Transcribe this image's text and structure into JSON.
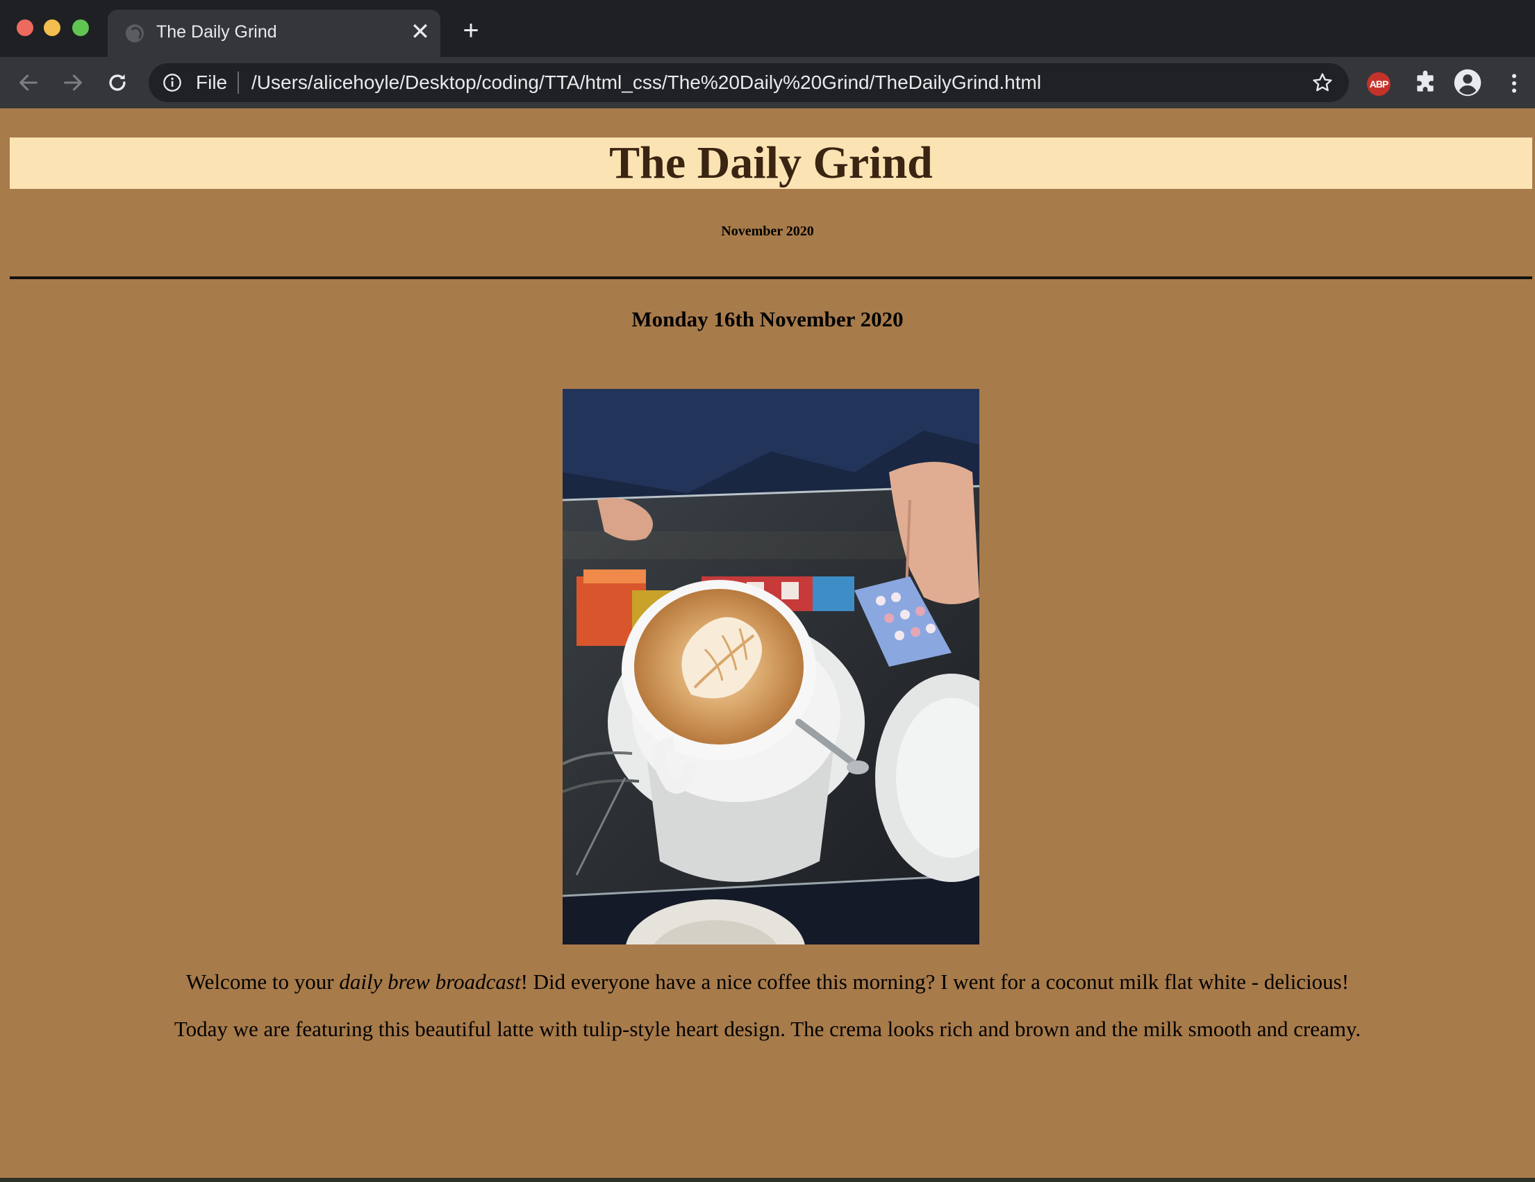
{
  "browser": {
    "tab_title": "The Daily Grind",
    "tab_close": "✕",
    "new_tab": "+",
    "address_scheme": "File",
    "address_url": "/Users/alicehoyle/Desktop/coding/TTA/html_css/The%20Daily%20Grind/TheDailyGrind.html",
    "extension_abp": "ABP",
    "icons": [
      "back-icon",
      "forward-icon",
      "reload-icon",
      "info-icon",
      "star-icon",
      "puzzle-icon",
      "profile-icon",
      "kebab-menu-icon"
    ]
  },
  "page": {
    "background_color": "#a87b4b",
    "masthead_color": "#fbe3b4",
    "title": "The Daily Grind",
    "issue": "November 2020",
    "post_date": "Monday 16th November 2020",
    "image_alt": "Latte with tulip-style heart design on a glass counter",
    "intro_before": "Welcome to your ",
    "intro_em": "daily brew broadcast",
    "intro_after": "! Did everyone have a nice coffee this morning? I went for a coconut milk flat white - delicious!",
    "feature": "Today we are featuring this beautiful latte with tulip-style heart design. The crema looks rich and brown and the milk smooth and creamy."
  }
}
